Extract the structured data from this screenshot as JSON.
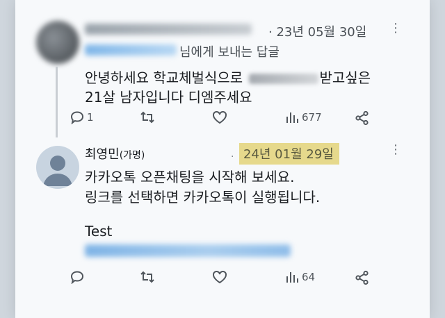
{
  "post1": {
    "date": "· 23년 05월 30일",
    "more": "⋮",
    "reply_to_suffix": "님에게 보내는 답글",
    "line1_before": "안녕하세요 학교체벌식으로 ",
    "line1_after": "받고싶은",
    "line2": "21살 남자입니다 디엠주세요",
    "actions": {
      "reply_count": "1",
      "retweet_count": "",
      "like_count": "",
      "views": "677"
    }
  },
  "post2": {
    "name": "최영민",
    "name_note": "(가명)",
    "date": "24년 01월 29일",
    "more": "⋮",
    "line1": "카카오톡 오픈채팅을 시작해 보세요.",
    "line2": "링크를 선택하면 카카오톡이 실행됩니다.",
    "line3": "Test",
    "actions": {
      "reply_count": "",
      "retweet_count": "",
      "like_count": "",
      "views": "64"
    }
  },
  "colors": {
    "highlight": "#e6d98c",
    "link_blur": "#8fbde9",
    "background": "#f7f9fb"
  }
}
